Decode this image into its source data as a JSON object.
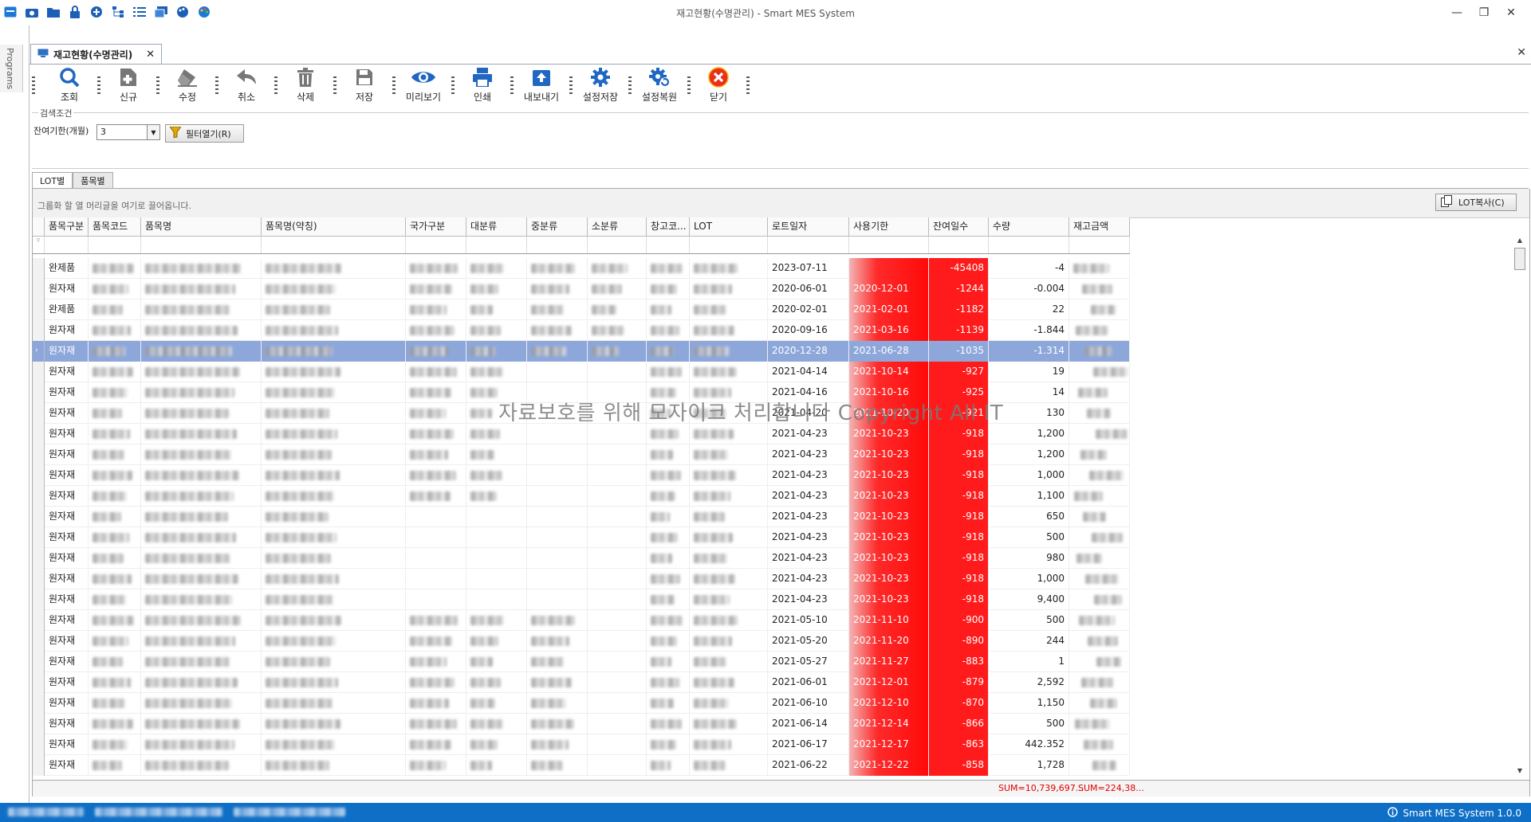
{
  "window": {
    "title": "재고현황(수명관리) - Smart MES System"
  },
  "left_strip": {
    "label": "Programs"
  },
  "doc_tab": {
    "label": "재고현황(수명관리)"
  },
  "toolbar": [
    {
      "name": "search",
      "label": "조회",
      "icon": "search-icon"
    },
    {
      "name": "new",
      "label": "신규",
      "icon": "add-doc-icon"
    },
    {
      "name": "edit",
      "label": "수정",
      "icon": "eraser-icon"
    },
    {
      "name": "cancel",
      "label": "취소",
      "icon": "undo-icon"
    },
    {
      "name": "delete",
      "label": "삭제",
      "icon": "trash-icon"
    },
    {
      "name": "save",
      "label": "저장",
      "icon": "floppy-icon"
    },
    {
      "name": "preview",
      "label": "미리보기",
      "icon": "eye-icon"
    },
    {
      "name": "print",
      "label": "인쇄",
      "icon": "printer-icon"
    },
    {
      "name": "export",
      "label": "내보내기",
      "icon": "export-icon"
    },
    {
      "name": "save-settings",
      "label": "설정저장",
      "icon": "gear-icon"
    },
    {
      "name": "restore-settings",
      "label": "설정복원",
      "icon": "gear-refresh-icon"
    },
    {
      "name": "close",
      "label": "닫기",
      "icon": "close-circle-icon"
    }
  ],
  "search": {
    "group_label": "검색조건",
    "remain_label": "잔여기한(개월)",
    "remain_value": "3",
    "filter_button": "필터열기(R)"
  },
  "subtabs": [
    "LOT별",
    "품목별"
  ],
  "grid": {
    "group_hint": "그룹화 할 열 머리글을 여기로 끌어옵니다.",
    "lot_copy": "LOT복사(C)",
    "columns": [
      "품목구분",
      "품목코드",
      "품목명",
      "품목명(약칭)",
      "국가구분",
      "대분류",
      "중분류",
      "소분류",
      "창고코...",
      "LOT",
      "로트일자",
      "사용기한",
      "잔여일수",
      "수량",
      "재고금액"
    ],
    "rows": [
      [
        "완제품",
        "2023-07-11",
        "",
        "-45408",
        "-4"
      ],
      [
        "원자재",
        "2020-06-01",
        "2020-12-01",
        "-1244",
        "-0.004"
      ],
      [
        "완제품",
        "2020-02-01",
        "2021-02-01",
        "-1182",
        "22"
      ],
      [
        "원자재",
        "2020-09-16",
        "2021-03-16",
        "-1139",
        "-1.844"
      ],
      [
        "원자재",
        "2020-12-28",
        "2021-06-28",
        "-1035",
        "-1.314"
      ],
      [
        "원자재",
        "2021-04-14",
        "2021-10-14",
        "-927",
        "19"
      ],
      [
        "원자재",
        "2021-04-16",
        "2021-10-16",
        "-925",
        "14"
      ],
      [
        "원자재",
        "2021-04-20",
        "2021-10-20",
        "-921",
        "130"
      ],
      [
        "원자재",
        "2021-04-23",
        "2021-10-23",
        "-918",
        "1,200"
      ],
      [
        "원자재",
        "2021-04-23",
        "2021-10-23",
        "-918",
        "1,200"
      ],
      [
        "원자재",
        "2021-04-23",
        "2021-10-23",
        "-918",
        "1,000"
      ],
      [
        "원자재",
        "2021-04-23",
        "2021-10-23",
        "-918",
        "1,100"
      ],
      [
        "원자재",
        "2021-04-23",
        "2021-10-23",
        "-918",
        "650"
      ],
      [
        "원자재",
        "2021-04-23",
        "2021-10-23",
        "-918",
        "500"
      ],
      [
        "원자재",
        "2021-04-23",
        "2021-10-23",
        "-918",
        "980"
      ],
      [
        "원자재",
        "2021-04-23",
        "2021-10-23",
        "-918",
        "1,000"
      ],
      [
        "원자재",
        "2021-04-23",
        "2021-10-23",
        "-918",
        "9,400"
      ],
      [
        "원자재",
        "2021-05-10",
        "2021-11-10",
        "-900",
        "500"
      ],
      [
        "원자재",
        "2021-05-20",
        "2021-11-20",
        "-890",
        "244"
      ],
      [
        "원자재",
        "2021-05-27",
        "2021-11-27",
        "-883",
        "1"
      ],
      [
        "원자재",
        "2021-06-01",
        "2021-12-01",
        "-879",
        "2,592"
      ],
      [
        "원자재",
        "2021-06-10",
        "2021-12-10",
        "-870",
        "1,150"
      ],
      [
        "원자재",
        "2021-06-14",
        "2021-12-14",
        "-866",
        "500"
      ],
      [
        "원자재",
        "2021-06-17",
        "2021-12-17",
        "-863",
        "442.352"
      ],
      [
        "원자재",
        "2021-06-22",
        "2021-12-22",
        "-858",
        "1,728"
      ]
    ],
    "selected_row": 4,
    "sum_qty": "SUM=10,739,697...",
    "sum_amount": "SUM=224,38...",
    "watermark": "자료보호를 위해 모자이크 처리합니다 Copyright All IT"
  },
  "status": {
    "app": "Smart MES System 1.0.0"
  },
  "colors": {
    "accent": "#0f6fc6",
    "expired": "#ff1b1b",
    "selection": "#8ea7db"
  }
}
